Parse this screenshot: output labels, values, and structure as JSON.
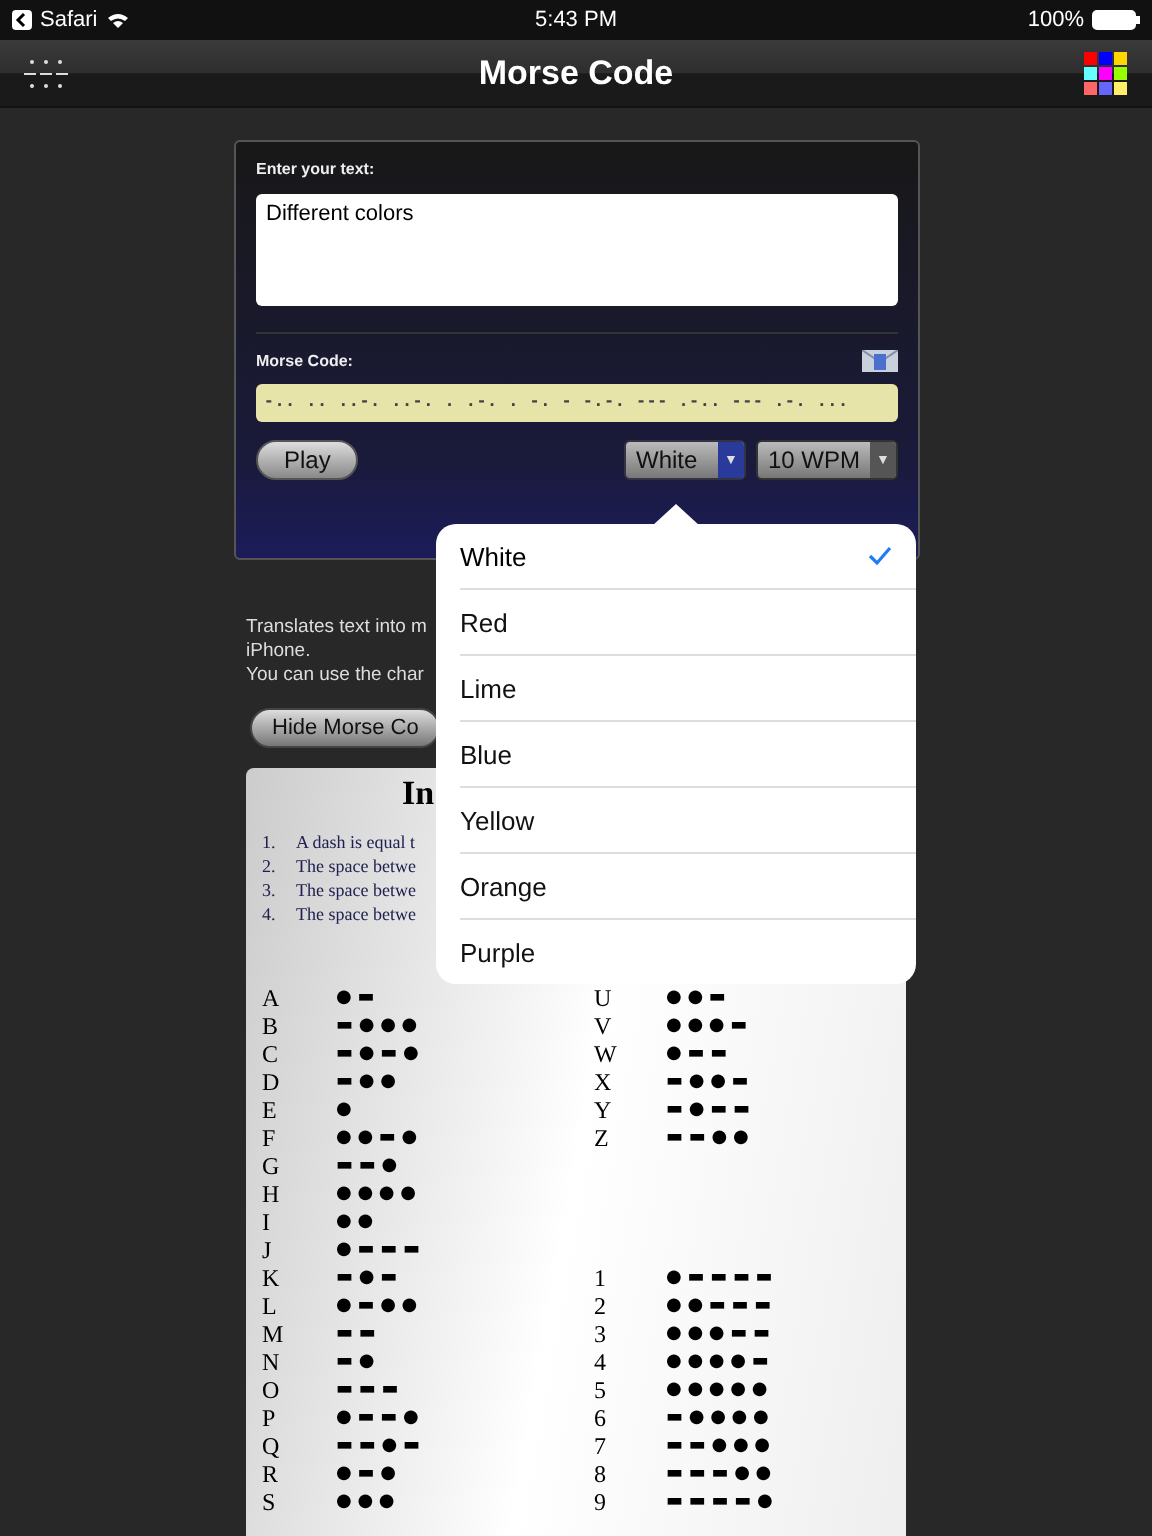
{
  "status_bar": {
    "back_app": "Safari",
    "time": "5:43 PM",
    "battery": "100%"
  },
  "nav": {
    "title": "Morse Code"
  },
  "translator": {
    "input_label": "Enter your text:",
    "input_value": "Different colors",
    "output_label": "Morse Code:",
    "output_value": "-.. .. ..-. ..-. . .-. . -. -   -.-. --- .-.. --- .-. ...",
    "play": "Play",
    "color_select": {
      "value": "White",
      "arrow": "▼",
      "open": true
    },
    "speed_select": {
      "value": "10 WPM",
      "arrow": "▼"
    }
  },
  "description": [
    "Translates text into m",
    "iPhone.",
    "You can use the char"
  ],
  "hide_button": "Hide Morse Co",
  "intro": {
    "title": "In",
    "items": [
      {
        "number": "1.",
        "text": "A dash is equal t"
      },
      {
        "number": "2.",
        "text": "The space betwe"
      },
      {
        "number": "3.",
        "text": "The space betwe"
      },
      {
        "number": "4.",
        "text": "The space betwe"
      }
    ]
  },
  "chart_rows": [
    {
      "left": {
        "letter": "A",
        "code": "● ▬"
      },
      "right": {
        "letter": "U",
        "code": "● ● ▬"
      }
    },
    {
      "left": {
        "letter": "B",
        "code": "▬ ● ● ●"
      },
      "right": {
        "letter": "V",
        "code": "● ● ● ▬"
      }
    },
    {
      "left": {
        "letter": "C",
        "code": "▬ ● ▬ ●"
      },
      "right": {
        "letter": "W",
        "code": "● ▬ ▬"
      }
    },
    {
      "left": {
        "letter": "D",
        "code": "▬ ● ●"
      },
      "right": {
        "letter": "X",
        "code": "▬ ● ● ▬"
      }
    },
    {
      "left": {
        "letter": "E",
        "code": "●"
      },
      "right": {
        "letter": "Y",
        "code": "▬ ● ▬ ▬"
      }
    },
    {
      "left": {
        "letter": "F",
        "code": "● ● ▬ ●"
      },
      "right": {
        "letter": "Z",
        "code": "▬ ▬ ● ●"
      }
    },
    {
      "left": {
        "letter": "G",
        "code": "▬ ▬ ●"
      }
    },
    {
      "left": {
        "letter": "H",
        "code": "● ● ● ●"
      }
    },
    {
      "left": {
        "letter": "I",
        "code": "● ●"
      }
    },
    {
      "left": {
        "letter": "J",
        "code": "● ▬ ▬ ▬"
      }
    },
    {
      "left": {
        "letter": "K",
        "code": "▬ ● ▬"
      },
      "right": {
        "letter": "1",
        "code": "● ▬ ▬ ▬ ▬"
      }
    },
    {
      "left": {
        "letter": "L",
        "code": "● ▬ ● ●"
      },
      "right": {
        "letter": "2",
        "code": "● ● ▬ ▬ ▬"
      }
    },
    {
      "left": {
        "letter": "M",
        "code": "▬ ▬"
      },
      "right": {
        "letter": "3",
        "code": "● ● ● ▬ ▬"
      }
    },
    {
      "left": {
        "letter": "N",
        "code": "▬ ●"
      },
      "right": {
        "letter": "4",
        "code": "● ● ● ● ▬"
      }
    },
    {
      "left": {
        "letter": "O",
        "code": "▬ ▬ ▬"
      },
      "right": {
        "letter": "5",
        "code": "● ● ● ● ●"
      }
    },
    {
      "left": {
        "letter": "P",
        "code": "● ▬ ▬ ●"
      },
      "right": {
        "letter": "6",
        "code": "▬ ● ● ● ●"
      }
    },
    {
      "left": {
        "letter": "Q",
        "code": "▬ ▬ ● ▬"
      },
      "right": {
        "letter": "7",
        "code": "▬ ▬ ● ● ●"
      }
    },
    {
      "left": {
        "letter": "R",
        "code": "● ▬ ●"
      },
      "right": {
        "letter": "8",
        "code": "▬ ▬ ▬ ● ●"
      }
    },
    {
      "left": {
        "letter": "S",
        "code": "● ● ●"
      },
      "right": {
        "letter": "9",
        "code": "▬ ▬ ▬ ▬ ●"
      }
    }
  ],
  "color_menu": [
    {
      "label": "White",
      "selected": true
    },
    {
      "label": "Red",
      "selected": false
    },
    {
      "label": "Lime",
      "selected": false
    },
    {
      "label": "Blue",
      "selected": false
    },
    {
      "label": "Yellow",
      "selected": false
    },
    {
      "label": "Orange",
      "selected": false
    },
    {
      "label": "Purple",
      "selected": false
    }
  ]
}
